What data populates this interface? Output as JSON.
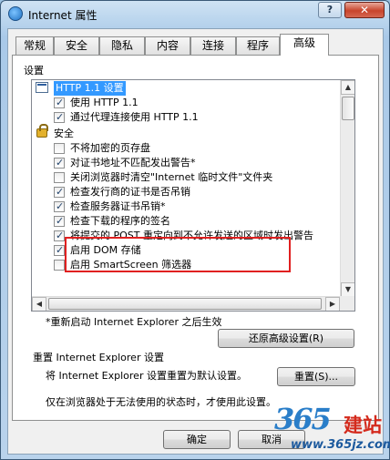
{
  "window": {
    "title": "Internet 属性",
    "help_label": "?",
    "close_label": "✕"
  },
  "tabs": [
    {
      "label": "常规"
    },
    {
      "label": "安全"
    },
    {
      "label": "隐私"
    },
    {
      "label": "内容"
    },
    {
      "label": "连接"
    },
    {
      "label": "程序"
    },
    {
      "label": "高级",
      "active": true
    }
  ],
  "settings": {
    "group_label": "设置",
    "items": [
      {
        "label": "HTTP 1.1 设置",
        "type": "folder"
      },
      {
        "label": "使用 HTTP 1.1",
        "type": "checkbox",
        "checked": true
      },
      {
        "label": "通过代理连接使用 HTTP 1.1",
        "type": "checkbox",
        "checked": true
      },
      {
        "label": "安全",
        "type": "lock"
      },
      {
        "label": "不将加密的页存盘",
        "type": "checkbox",
        "checked": false
      },
      {
        "label": "对证书地址不匹配发出警告*",
        "type": "checkbox",
        "checked": true
      },
      {
        "label": "关闭浏览器时清空\"Internet 临时文件\"文件夹",
        "type": "checkbox",
        "checked": false
      },
      {
        "label": "检查发行商的证书是否吊销",
        "type": "checkbox",
        "checked": true
      },
      {
        "label": "检查服务器证书吊销*",
        "type": "checkbox",
        "checked": true
      },
      {
        "label": "检查下载的程序的签名",
        "type": "checkbox",
        "checked": true
      },
      {
        "label": "将提交的 POST 重定向到不允许发送的区域时发出警告",
        "type": "checkbox",
        "checked": true
      },
      {
        "label": "启用 DOM 存储",
        "type": "checkbox",
        "checked": true
      },
      {
        "label": "启用 SmartScreen 筛选器",
        "type": "checkbox",
        "checked": false
      }
    ]
  },
  "restart_note": "*重新启动 Internet Explorer 之后生效",
  "restore_button": "还原高级设置(R)",
  "reset": {
    "title": "重置 Internet Explorer 设置",
    "description": "将 Internet Explorer 设置重置为默认设置。",
    "button": "重置(S)...",
    "hint": "仅在浏览器处于无法使用的状态时，才使用此设置。"
  },
  "footer": {
    "ok": "确定",
    "cancel": "取消"
  },
  "watermark": {
    "number": "365",
    "name": "建站",
    "url": "www.365jz.com"
  }
}
